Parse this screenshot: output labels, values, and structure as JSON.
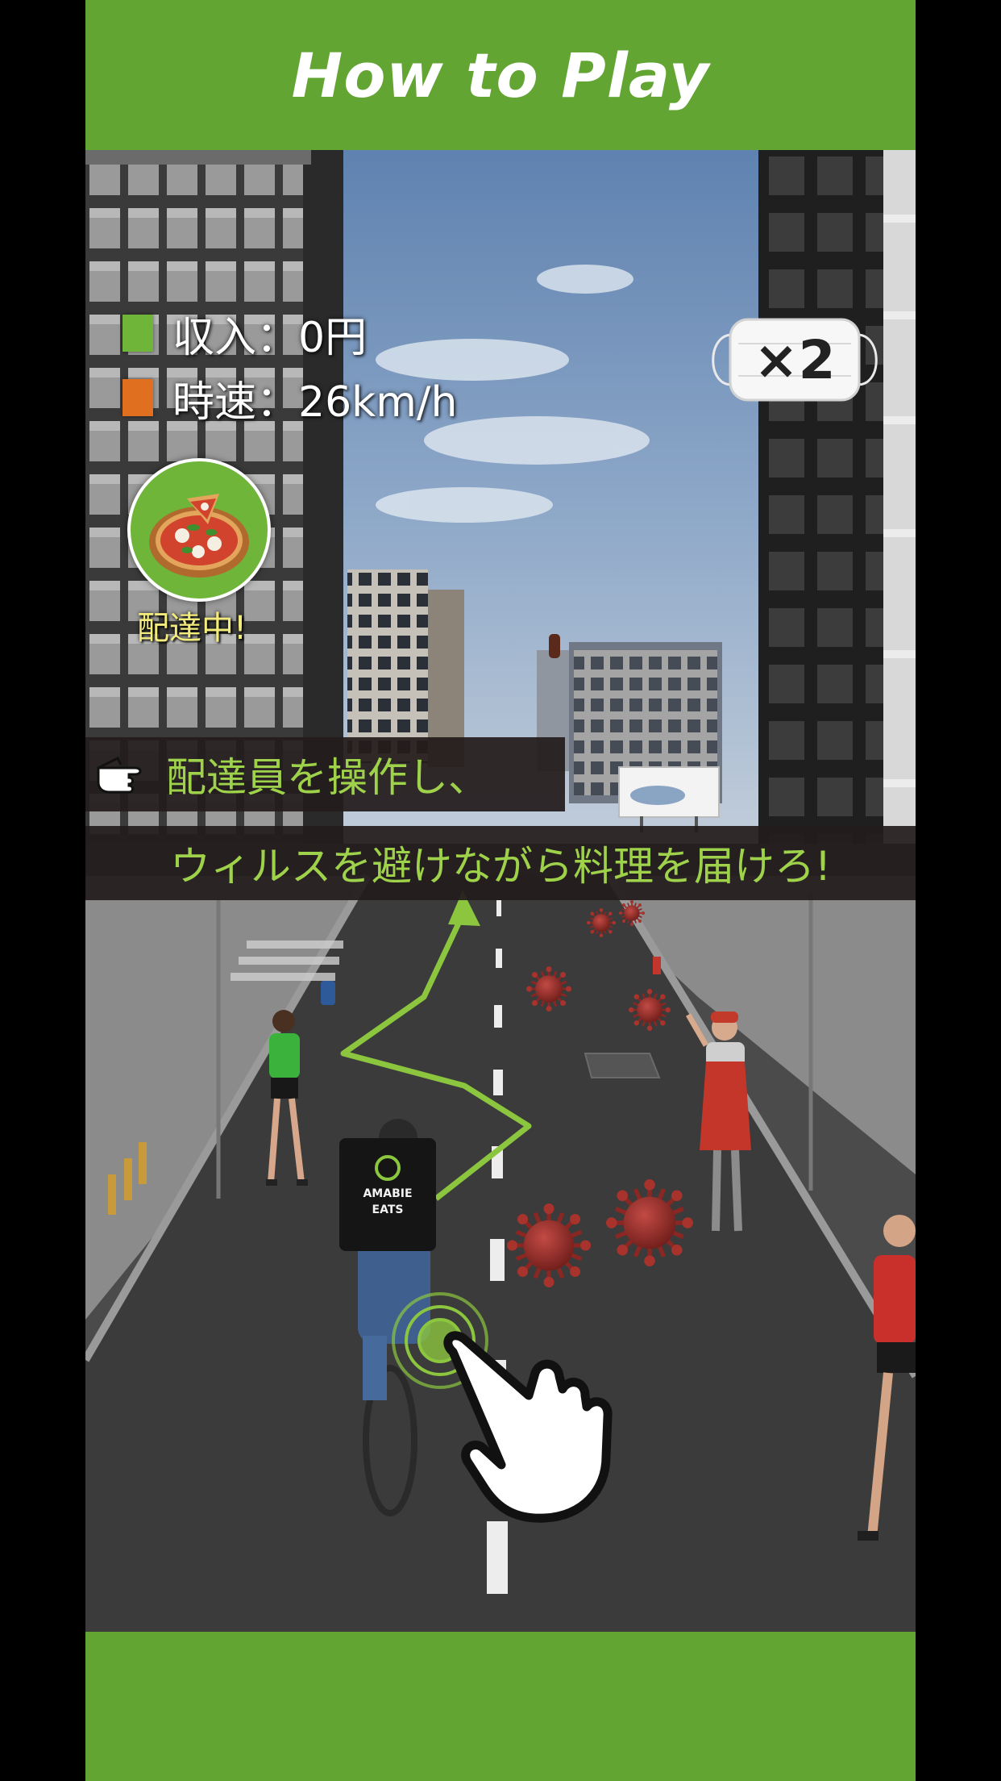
{
  "header": {
    "title": "How to Play"
  },
  "hud": {
    "income_text": "収入：0円",
    "speed_text": "時速：26km/h",
    "income_color": "#6fb53a",
    "speed_color": "#e07020"
  },
  "delivery": {
    "status_text": "配達中!",
    "item_icon": "pizza-icon"
  },
  "mask": {
    "multiplier_text": "×2"
  },
  "backpack": {
    "line1": "AMABIE",
    "line2": "EATS"
  },
  "instructions": {
    "line1": "配達員を操作し、",
    "line2": "ウィルスを避けながら料理を届けろ!"
  },
  "colors": {
    "brand_green": "#62a533",
    "caption_text": "#9fd24b",
    "caption_bg": "#231c1c"
  }
}
